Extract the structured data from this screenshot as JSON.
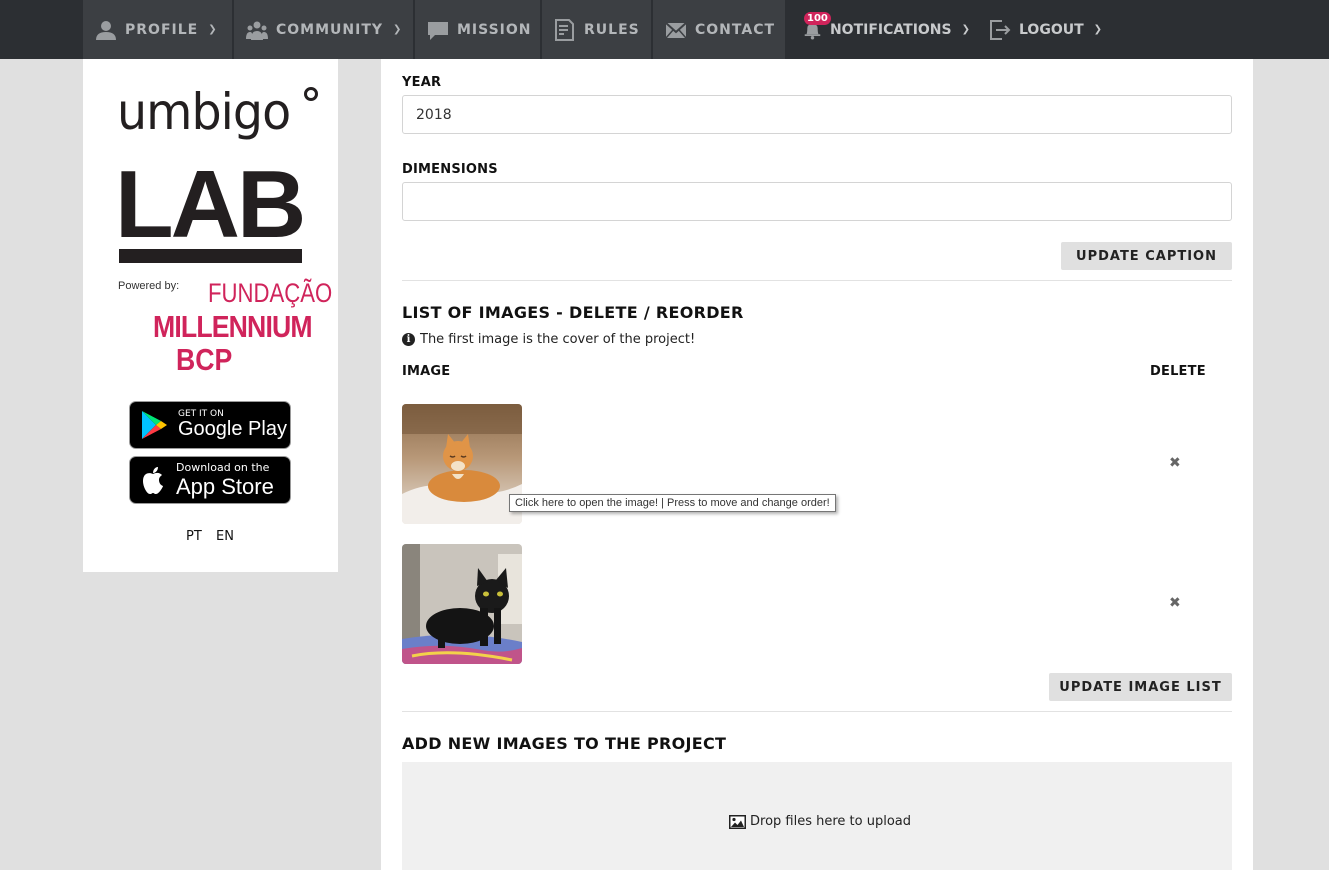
{
  "nav": {
    "profile": "PROFILE",
    "community": "COMMUNITY",
    "mission": "MISSION",
    "rules": "RULES",
    "contact": "CONTACT",
    "notifications": "NOTIFICATIONS",
    "notifications_count": "100",
    "logout": "LOGOUT"
  },
  "sidebar": {
    "logo_top": "umbigo",
    "logo_main": "LAB",
    "powered_by": "Powered by:",
    "sponsor_line1": "FUNDAÇÃO",
    "sponsor_line2": "MILLENNIUM",
    "sponsor_line3": "BCP",
    "google_small": "GET IT ON",
    "google_big": "Google Play",
    "apple_small": "Download on the",
    "apple_big": "App Store",
    "lang_pt": "PT",
    "lang_en": "EN"
  },
  "form": {
    "year_label": "YEAR",
    "year_value": "2018",
    "dimensions_label": "DIMENSIONS",
    "dimensions_value": "",
    "update_caption": "UPDATE CAPTION"
  },
  "images": {
    "heading": "LIST OF IMAGES - DELETE / REORDER",
    "info": "The first image is the cover of the project!",
    "col_image": "IMAGE",
    "col_delete": "DELETE",
    "tooltip": "Click here to open the image! | Press to move and change order!",
    "update_list": "UPDATE IMAGE LIST"
  },
  "upload": {
    "heading": "ADD NEW IMAGES TO THE PROJECT",
    "drop_text": "Drop files here to upload"
  },
  "colors": {
    "nav_bg": "#2c2f33",
    "accent": "#d0245b"
  }
}
